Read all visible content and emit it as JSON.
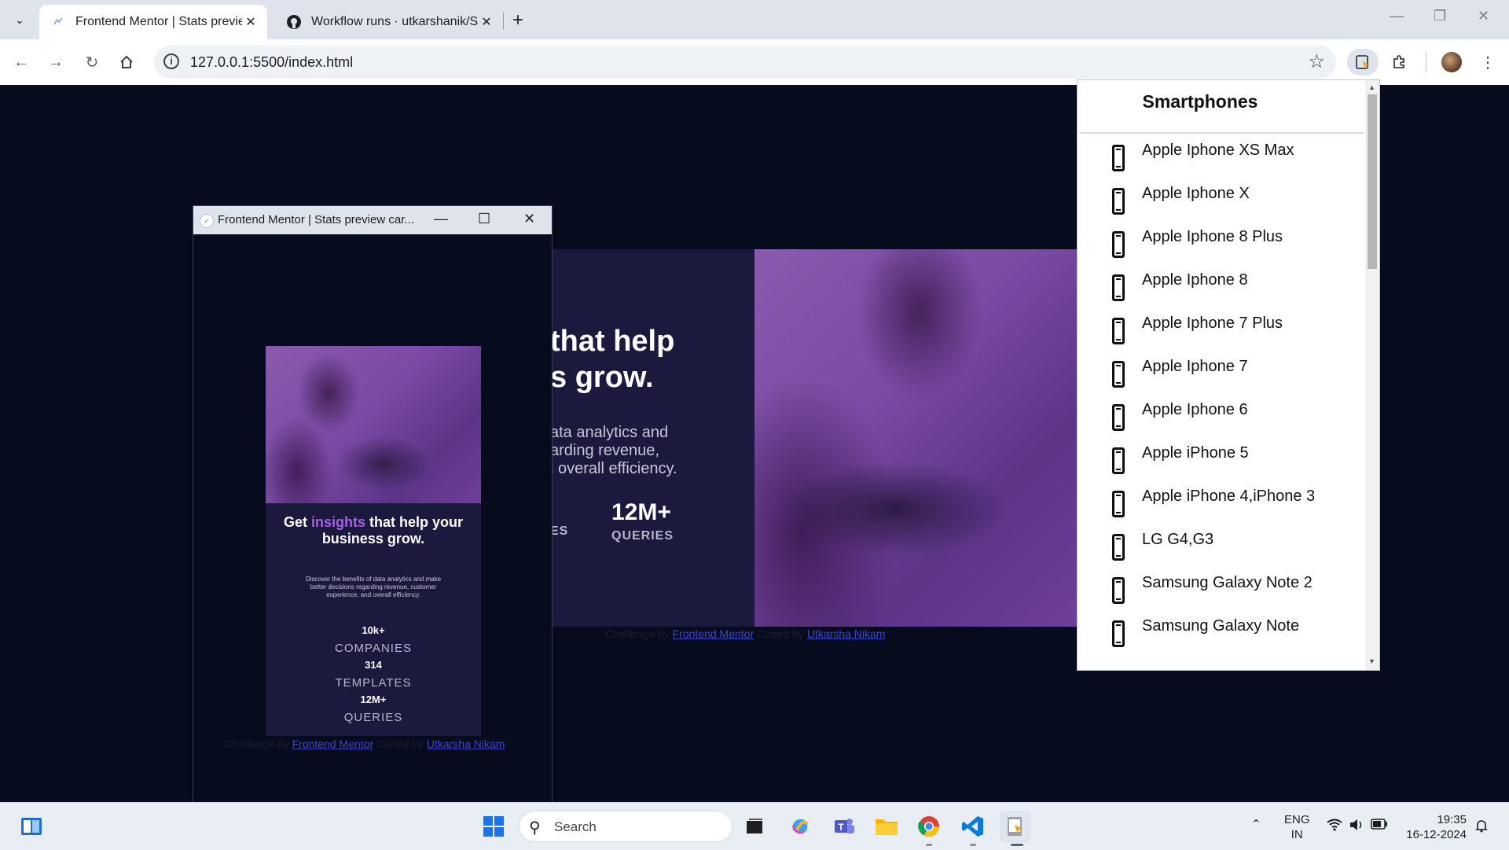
{
  "browser": {
    "tabs": [
      {
        "title": "Frontend Mentor | Stats previev",
        "active": true
      },
      {
        "title": "Workflow runs · utkarshanik/Sta",
        "active": false
      }
    ],
    "new_tab": "+",
    "url": "127.0.0.1:5500/index.html"
  },
  "page": {
    "desktop_card": {
      "heading_line1": "that help",
      "heading_line2": "s grow.",
      "desc_line1": "ata analytics and",
      "desc_line2": "arding revenue,",
      "desc_line3": "l overall efficiency.",
      "stat_partial_label": "ES",
      "stat_queries_value": "12M+",
      "stat_queries_label": "QUERIES"
    },
    "desktop_credit": {
      "prefix": "Challenge by",
      "link1": "Frontend Mentor",
      "middle": "Coded by",
      "link2": "Utkarsha Nikam"
    }
  },
  "popup_window": {
    "title": "Frontend Mentor | Stats preview car...",
    "card": {
      "heading_pre": "Get ",
      "heading_accent": "insights",
      "heading_post": " that help your business grow.",
      "description": "Discover the benefits of data analytics and make better decisions regarding revenue, customer experience, and overall efficiency.",
      "stats": [
        {
          "value": "10k+",
          "label": "COMPANIES"
        },
        {
          "value": "314",
          "label": "TEMPLATES"
        },
        {
          "value": "12M+",
          "label": "QUERIES"
        }
      ]
    },
    "credit": {
      "prefix": "Challenge by",
      "link1": "Frontend Mentor",
      "middle": "Coded by",
      "link2": "Utkarsha Nikam"
    }
  },
  "device_popup": {
    "title": "Smartphones",
    "devices": [
      "Apple Iphone XS Max",
      "Apple Iphone X",
      "Apple Iphone 8 Plus",
      "Apple Iphone 8",
      "Apple Iphone 7 Plus",
      "Apple Iphone 7",
      "Apple Iphone 6",
      "Apple iPhone 5",
      "Apple iPhone 4,iPhone 3",
      "LG G4,G3",
      "Samsung Galaxy Note 2",
      "Samsung Galaxy Note"
    ]
  },
  "taskbar": {
    "search_placeholder": "Search",
    "language": "ENG",
    "region": "IN",
    "time": "19:35",
    "date": "16-12-2024"
  },
  "colors": {
    "page_bg": "#070b1e",
    "card_bg": "#1b1a3e",
    "accent": "#a95ee6",
    "image_tint": "#7a4aa5"
  }
}
